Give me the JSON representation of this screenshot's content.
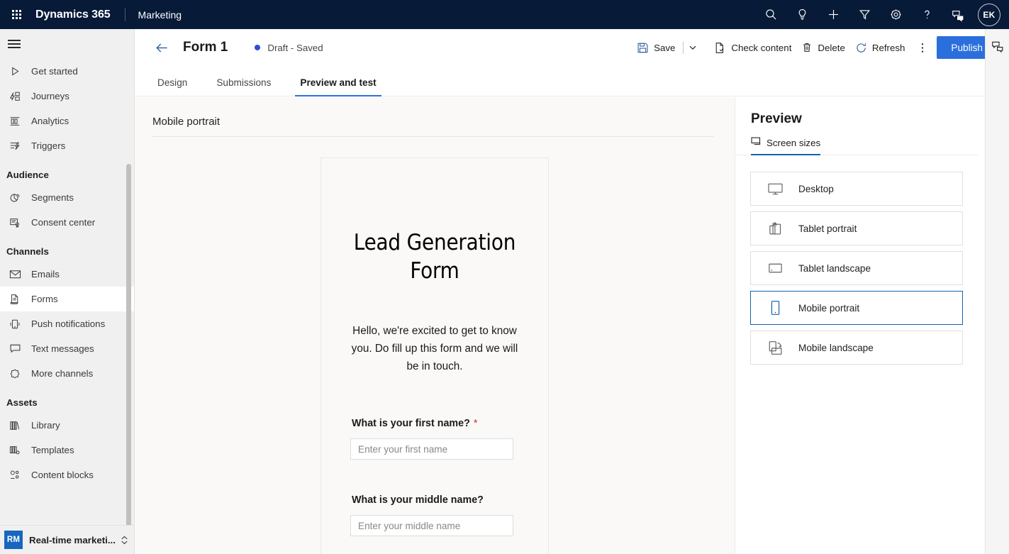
{
  "topbar": {
    "waffle_label": "app-launcher",
    "brand": "Dynamics 365",
    "app_name": "Marketing",
    "icons": [
      "search-icon",
      "lightbulb-icon",
      "plus-icon",
      "filter-icon",
      "gear-icon",
      "help-icon",
      "feedback-icon"
    ],
    "avatar_initials": "EK",
    "background_color": "#071a38"
  },
  "sidebar": {
    "hamburger_label": "Collapse site map",
    "items": [
      {
        "label": "Get started",
        "icon": "play-icon",
        "selected": false
      },
      {
        "label": "Journeys",
        "icon": "journeys-icon",
        "selected": false
      },
      {
        "label": "Analytics",
        "icon": "analytics-icon",
        "selected": false
      },
      {
        "label": "Triggers",
        "icon": "triggers-icon",
        "selected": false
      }
    ],
    "groups": [
      {
        "title": "Audience",
        "items": [
          {
            "label": "Segments",
            "icon": "segments-icon",
            "selected": false
          },
          {
            "label": "Consent center",
            "icon": "consent-icon",
            "selected": false
          }
        ]
      },
      {
        "title": "Channels",
        "items": [
          {
            "label": "Emails",
            "icon": "email-icon",
            "selected": false
          },
          {
            "label": "Forms",
            "icon": "forms-icon",
            "selected": true
          },
          {
            "label": "Push notifications",
            "icon": "push-notification-icon",
            "selected": false
          },
          {
            "label": "Text messages",
            "icon": "text-message-icon",
            "selected": false
          },
          {
            "label": "More channels",
            "icon": "more-channels-icon",
            "selected": false
          }
        ]
      },
      {
        "title": "Assets",
        "items": [
          {
            "label": "Library",
            "icon": "library-icon",
            "selected": false
          },
          {
            "label": "Templates",
            "icon": "templates-icon",
            "selected": false
          },
          {
            "label": "Content blocks",
            "icon": "content-blocks-icon",
            "selected": false
          }
        ]
      }
    ],
    "area_switcher": {
      "badge": "RM",
      "label": "Real-time marketi...",
      "icon": "area-switcher-chevron-icon"
    },
    "background_color": "#f0f0f0"
  },
  "commandbar": {
    "back_label": "Back",
    "form_title": "Form 1",
    "status": "Draft - Saved",
    "status_dot_color": "#2a50d8",
    "save_label": "Save",
    "check_content_label": "Check content",
    "delete_label": "Delete",
    "refresh_label": "Refresh",
    "overflow_label": "More commands",
    "publish_label": "Publish",
    "publish_color": "#2b6fdd"
  },
  "tabs": [
    {
      "label": "Design",
      "active": false
    },
    {
      "label": "Submissions",
      "active": false
    },
    {
      "label": "Preview and test",
      "active": true
    }
  ],
  "canvas": {
    "device_label": "Mobile portrait",
    "form": {
      "heading": "Lead Generation Form",
      "subtext": "Hello, we're excited to get to know you. Do fill up this form and we will be in touch.",
      "fields": [
        {
          "label": "What is your first name?",
          "required": true,
          "required_marker": "*",
          "placeholder": "Enter your first name",
          "value": ""
        },
        {
          "label": "What is your middle name?",
          "required": false,
          "required_marker": "",
          "placeholder": "Enter your middle name",
          "value": ""
        }
      ]
    }
  },
  "preview_panel": {
    "title": "Preview",
    "tab_label": "Screen sizes",
    "tab_icon": "screen-sizes-icon",
    "accent_color": "#0f62b0",
    "sizes": [
      {
        "label": "Desktop",
        "icon": "desktop-icon",
        "selected": false
      },
      {
        "label": "Tablet portrait",
        "icon": "tablet-portrait-icon",
        "selected": false
      },
      {
        "label": "Tablet landscape",
        "icon": "tablet-landscape-icon",
        "selected": false
      },
      {
        "label": "Mobile portrait",
        "icon": "mobile-portrait-icon",
        "selected": true
      },
      {
        "label": "Mobile landscape",
        "icon": "mobile-landscape-icon",
        "selected": false
      }
    ]
  },
  "right_rail": {
    "feedback_icon": "feedback-icon"
  }
}
